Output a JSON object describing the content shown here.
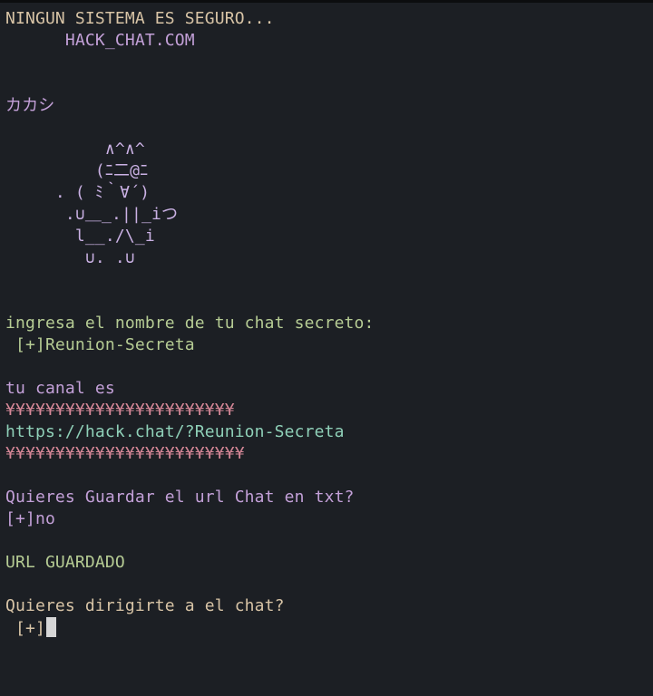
{
  "banner": {
    "line1": "NINGUN SISTEMA ES SEGURO...",
    "line2": "      HACK_CHAT.COM"
  },
  "name": "カカシ",
  "ascii_art": [
    "          ∧^∧^",
    "         (ﾆ二@ﾆ",
    "     . ( ﾐ｀∀´)",
    "      .∪＿_.||_iつ",
    "       l__./\\_i",
    "        ∪. .∪"
  ],
  "prompt_chat_name": "ingresa el nombre de tu chat secreto:",
  "chat_name_input": " [+]Reunion-Secreta",
  "channel_label": "tu canal es",
  "separator_top": "¥¥¥¥¥¥¥¥¥¥¥¥¥¥¥¥¥¥¥¥¥¥¥",
  "channel_url": "https://hack.chat/?Reunion-Secreta",
  "separator_bottom": "¥¥¥¥¥¥¥¥¥¥¥¥¥¥¥¥¥¥¥¥¥¥¥¥",
  "save_prompt": "Quieres Guardar el url Chat en txt?",
  "save_answer": "[+]no",
  "saved_msg": "URL GUARDADO",
  "go_prompt": "Quieres dirigirte a el chat?",
  "go_input": " [+]",
  "colors": {
    "background": "#1c1f24",
    "tan": "#d8c4a6",
    "purple": "#c3a0d8",
    "green": "#b6cc94",
    "teal": "#8fd0b8",
    "pink": "#d58797"
  }
}
